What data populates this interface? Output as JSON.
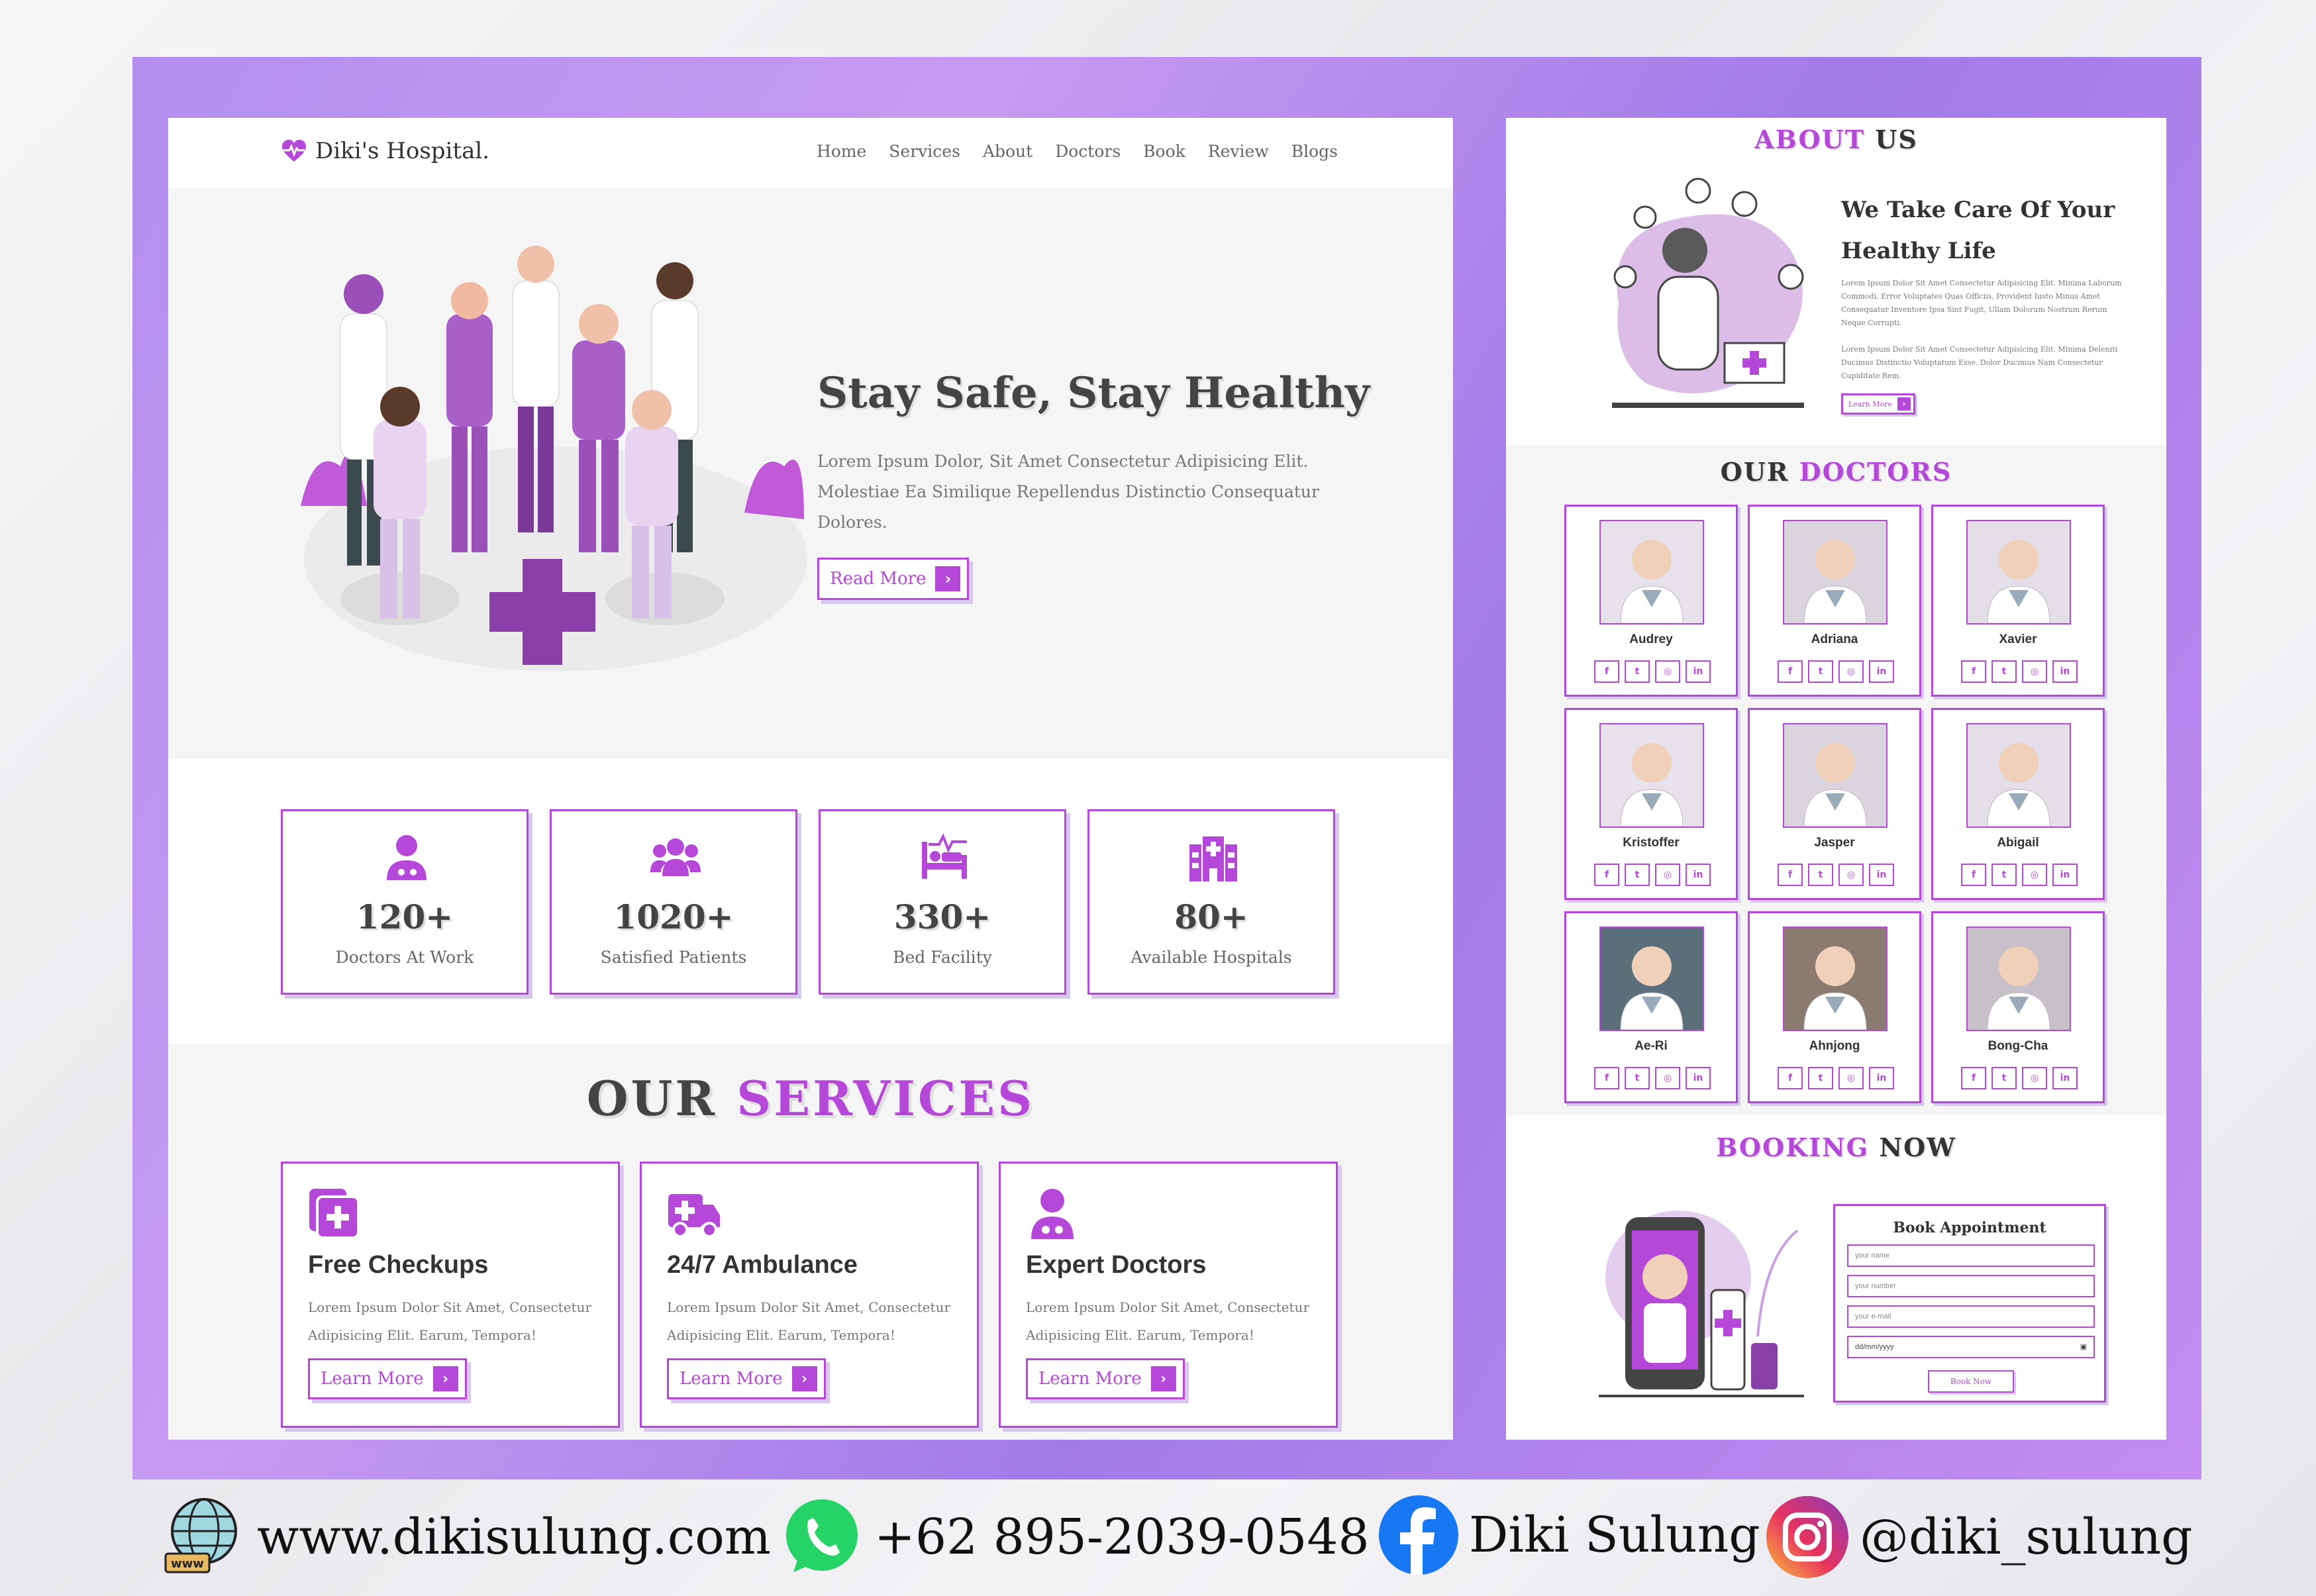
{
  "brand": {
    "name": "Diki's Hospital.",
    "accent": "#b548d8"
  },
  "nav": {
    "items": [
      "Home",
      "Services",
      "About",
      "Doctors",
      "Book",
      "Review",
      "Blogs"
    ]
  },
  "hero": {
    "title": "Stay Safe, Stay Healthy",
    "description": "Lorem Ipsum Dolor, Sit Amet Consectetur Adipisicing Elit. Molestiae Ea Similique Repellendus Distinctio Consequatur Dolores.",
    "button_label": "Read More"
  },
  "stats": [
    {
      "number": "120+",
      "label": "Doctors At Work",
      "icon": "doctor-icon"
    },
    {
      "number": "1020+",
      "label": "Satisfied Patients",
      "icon": "users-icon"
    },
    {
      "number": "330+",
      "label": "Bed Facility",
      "icon": "bed-icon"
    },
    {
      "number": "80+",
      "label": "Available Hospitals",
      "icon": "hospital-icon"
    }
  ],
  "services": {
    "title_part1": "OUR",
    "title_part2": "SERVICES",
    "items": [
      {
        "title": "Free Checkups",
        "description": "Lorem Ipsum Dolor Sit Amet, Consectetur Adipisicing Elit. Earum, Tempora!",
        "button_label": "Learn More",
        "icon": "notes-medical-icon"
      },
      {
        "title": "24/7 Ambulance",
        "description": "Lorem Ipsum Dolor Sit Amet, Consectetur Adipisicing Elit. Earum, Tempora!",
        "button_label": "Learn More",
        "icon": "ambulance-icon"
      },
      {
        "title": "Expert Doctors",
        "description": "Lorem Ipsum Dolor Sit Amet, Consectetur Adipisicing Elit. Earum, Tempora!",
        "button_label": "Learn More",
        "icon": "doctor-icon"
      }
    ]
  },
  "about": {
    "title_part1": "ABOUT",
    "title_part2": "US",
    "heading": "We Take Care Of Your Healthy Life",
    "paragraph1": "Lorem Ipsum Dolor Sit Amet Consectetur Adipisicing Elit. Minima Laborum Commodi, Error Voluptates Quas Officiis, Provident Iusto Minus Amet Consequatur Inventore Ipsa Sint Fugit, Ullam Dolorum Nostrum Rerum Neque Corrupti.",
    "paragraph2": "Lorem Ipsum Dolor Sit Amet Consectetur Adipisicing Elit. Minima Deleniti Ducimus Distinctio Voluptatum Esse. Dolor Ducimus Nam Consectetur Cupiditate Rem.",
    "button_label": "Learn More"
  },
  "doctors": {
    "title_part1": "OUR",
    "title_part2": "DOCTORS",
    "items": [
      {
        "name": "Audrey"
      },
      {
        "name": "Adriana"
      },
      {
        "name": "Xavier"
      },
      {
        "name": "Kristoffer"
      },
      {
        "name": "Jasper"
      },
      {
        "name": "Abigail"
      },
      {
        "name": "Ae-Ri"
      },
      {
        "name": "Ahnjong"
      },
      {
        "name": "Bong-Cha"
      }
    ],
    "social_icons": [
      "facebook-icon",
      "twitter-icon",
      "instagram-icon",
      "linkedin-icon"
    ]
  },
  "booking": {
    "title_part1": "BOOKING",
    "title_part2": "NOW",
    "form_title": "Book Appointment",
    "name_placeholder": "your name",
    "number_placeholder": "your number",
    "email_placeholder": "your e-mail",
    "date_placeholder": "dd/mm/yyyy",
    "submit_label": "Book Now"
  },
  "footer": {
    "website": "www.dikisulung.com",
    "phone": "+62 895-2039-0548",
    "facebook": "Diki Sulung",
    "instagram": "@diki_sulung"
  }
}
